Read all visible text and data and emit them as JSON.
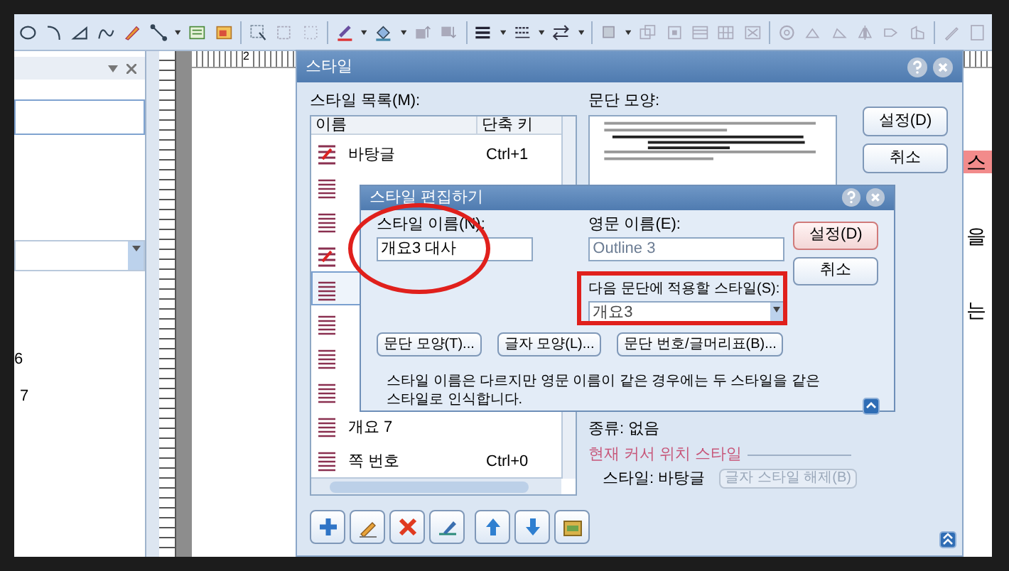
{
  "left_panel": {
    "row_labels": [
      "6",
      "7"
    ]
  },
  "ruler": {
    "mark": "2"
  },
  "document": {
    "texts": [
      {
        "text": "스",
        "highlighted": true
      },
      {
        "text": "을",
        "highlighted": false
      },
      {
        "text": "는",
        "highlighted": false
      }
    ]
  },
  "style_dialog": {
    "title": "스타일",
    "list_label": "스타일 목록(M):",
    "columns": [
      "이름",
      "단축 키"
    ],
    "items": [
      {
        "name": "바탕글",
        "shortcut": "Ctrl+1",
        "kind": "character",
        "selected": false
      },
      {
        "kind": "paragraph",
        "selected": false
      },
      {
        "kind": "paragraph",
        "selected": false
      },
      {
        "kind": "character",
        "selected": false
      },
      {
        "kind": "paragraph",
        "selected": true
      },
      {
        "kind": "paragraph",
        "selected": false
      },
      {
        "kind": "paragraph",
        "selected": false
      },
      {
        "kind": "paragraph",
        "selected": false
      },
      {
        "name": "개요 7",
        "kind": "paragraph",
        "selected": false
      },
      {
        "name": "쪽 번호",
        "shortcut": "Ctrl+0",
        "kind": "paragraph",
        "selected": false
      }
    ],
    "preview_label": "문단 모양:",
    "buttons": [
      "설정(D)",
      "취소"
    ],
    "type_label": "종류: 없음",
    "cursor_section": "현재 커서 위치 스타일",
    "cursor_style": "스타일: 바탕글",
    "clear_button": {
      "label": "글자 스타일 해제(B)",
      "disabled": true
    }
  },
  "edit_dialog": {
    "title": "스타일 편집하기",
    "name_label": "스타일 이름(N):",
    "name_value": "개요3 대사",
    "english_label": "영문 이름(E):",
    "english_value": "Outline 3",
    "next_label": "다음 문단에 적용할 스타일(S):",
    "next_value": "개요3",
    "buttons": [
      {
        "label": "설정(D)",
        "default": true
      },
      {
        "label": "취소",
        "default": false
      }
    ],
    "format_buttons": [
      "문단 모양(T)...",
      "글자 모양(L)...",
      "문단 번호/글머리표(B)..."
    ],
    "note": "스타일 이름은 다르지만 영문 이름이 같은 경우에는 두 스타일을 같은 스타일로 인식합니다."
  },
  "annotations": [
    {
      "kind": "ellipse"
    },
    {
      "kind": "rectangle"
    }
  ]
}
